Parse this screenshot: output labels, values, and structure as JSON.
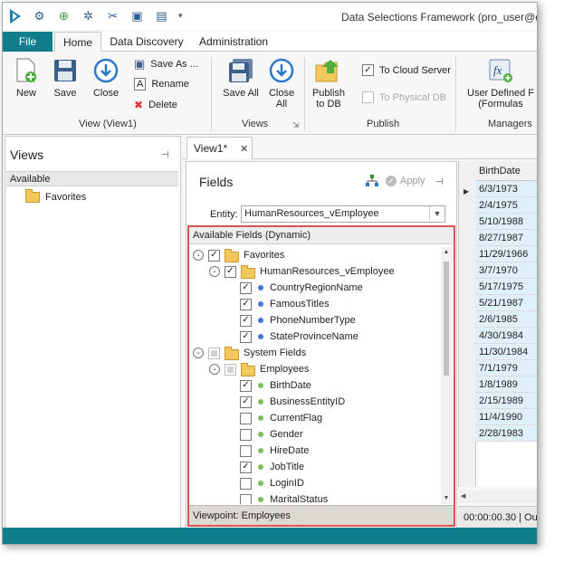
{
  "title": "Data Selections Framework (pro_user@dsf.",
  "quick_access": [
    "wrench-gear-icon",
    "add-green-icon",
    "gears-icon",
    "tools-icon",
    "save-icon",
    "save-all-icon"
  ],
  "tabs": {
    "file": "File",
    "items": [
      "Home",
      "Data Discovery",
      "Administration"
    ],
    "active": "Home"
  },
  "ribbon": {
    "new": "New",
    "save": "Save",
    "close": "Close",
    "save_as": "Save As ...",
    "rename": "Rename",
    "delete": "Delete",
    "group_view": "View (View1)",
    "save_all_line1": "Save All",
    "close_all_line1": "Close",
    "close_all_line2": "All",
    "group_views": "Views",
    "publish_line1": "Publish",
    "publish_line2": "to DB",
    "to_cloud": "To Cloud Server",
    "to_physical": "To Physical DB",
    "to_cloud_checked": true,
    "to_physical_checked": false,
    "group_publish": "Publish",
    "udf_line1": "User Defined F",
    "udf_line2": "(Formulas",
    "group_managers": "Managers"
  },
  "views_panel": {
    "title": "Views",
    "available": "Available",
    "favorites": "Favorites"
  },
  "doc_tab": {
    "label": "View1*",
    "close": "✕"
  },
  "fields_panel": {
    "title": "Fields",
    "apply": "Apply",
    "entity_label": "Entity:",
    "entity_value": "HumanResources_vEmployee",
    "available_header": "Available Fields (Dynamic)",
    "viewpoint": "Viewpoint: Employees",
    "tree": [
      {
        "label": "Favorites",
        "level": 0,
        "type": "folder",
        "checked": "yes",
        "expander": true,
        "dot": ""
      },
      {
        "label": "HumanResources_vEmployee",
        "level": 1,
        "type": "folder",
        "checked": "yes",
        "expander": true,
        "dot": ""
      },
      {
        "label": "CountryRegionName",
        "level": 2,
        "type": "field",
        "checked": "yes",
        "expander": false,
        "dot": "blue"
      },
      {
        "label": "FamousTitles",
        "level": 2,
        "type": "field",
        "checked": "yes",
        "expander": false,
        "dot": "blue"
      },
      {
        "label": "PhoneNumberType",
        "level": 2,
        "type": "field",
        "checked": "yes",
        "expander": false,
        "dot": "blue"
      },
      {
        "label": "StateProvinceName",
        "level": 2,
        "type": "field",
        "checked": "yes",
        "expander": false,
        "dot": "blue"
      },
      {
        "label": "System Fields",
        "level": 0,
        "type": "folder",
        "checked": "partial",
        "expander": true,
        "dot": ""
      },
      {
        "label": "Employees",
        "level": 1,
        "type": "folder",
        "checked": "partial",
        "expander": true,
        "dot": ""
      },
      {
        "label": "BirthDate",
        "level": 2,
        "type": "field",
        "checked": "yes",
        "expander": false,
        "dot": "green"
      },
      {
        "label": "BusinessEntityID",
        "level": 2,
        "type": "field",
        "checked": "yes",
        "expander": false,
        "dot": "green"
      },
      {
        "label": "CurrentFlag",
        "level": 2,
        "type": "field",
        "checked": "no",
        "expander": false,
        "dot": "green"
      },
      {
        "label": "Gender",
        "level": 2,
        "type": "field",
        "checked": "no",
        "expander": false,
        "dot": "green"
      },
      {
        "label": "HireDate",
        "level": 2,
        "type": "field",
        "checked": "no",
        "expander": false,
        "dot": "green"
      },
      {
        "label": "JobTitle",
        "level": 2,
        "type": "field",
        "checked": "yes",
        "expander": false,
        "dot": "green"
      },
      {
        "label": "LoginID",
        "level": 2,
        "type": "field",
        "checked": "no",
        "expander": false,
        "dot": "green"
      },
      {
        "label": "MaritalStatus",
        "level": 2,
        "type": "field",
        "checked": "no",
        "expander": false,
        "dot": "green"
      }
    ]
  },
  "grid": {
    "header": "BirthDate",
    "rows": [
      "6/3/1973",
      "2/4/1975",
      "5/10/1988",
      "8/27/1987",
      "11/29/1966",
      "3/7/1970",
      "5/17/1975",
      "5/21/1987",
      "2/6/1985",
      "4/30/1984",
      "11/30/1984",
      "7/1/1979",
      "1/8/1989",
      "2/15/1989",
      "11/4/1990",
      "2/28/1983"
    ],
    "status": "00:00:00.30 | Ou"
  },
  "colors": {
    "accent": "#0f7d8c",
    "highlight_border": "#d9534f",
    "grid_row": "#dff0fa"
  }
}
